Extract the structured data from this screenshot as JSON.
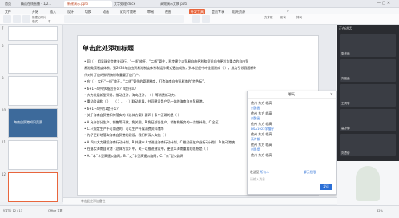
{
  "tabs": [
    "首页",
    "精选在线直播 - 1/2...",
    "新建演示.pptx",
    "文字处理.docx",
    "高效演示文稿 pptx"
  ],
  "menus": [
    "文件",
    "开始",
    "插入",
    "设计",
    "切换",
    "动画",
    "幻灯片放映",
    "审阅",
    "视图",
    "开发工具",
    "会员专享",
    "稻壳资源"
  ],
  "toolbar": {
    "new_slide": "新建幻灯片",
    "layout": "版式",
    "section": "节",
    "textbox": "文本框",
    "shapes": "形状",
    "arrange": "排列"
  },
  "slide": {
    "title": "单击此处添加标题",
    "lines": [
      "• 同（  ）相吴瑞全会转关运行，“一线”放开，“二线”管住，积步建立以贸易自由便利和投资自由便利为重点的自由贸",
      "  易港政策制度体系，到2035年自由贸易港制度体系和运作模式更加成熟，到本世纪中叶全面建成（  ），成为引领我国新时",
      "  代对外开放的鲜明旗帜和重要开放门户。",
      "• 应（  ）实行“一线”放开，“二线”管住的管理制度，打造海南自由贸易港的“特色标”。",
      "• 6+1+4中的6指应什么？4是什么？",
      "• 大力发展新型贸易、推动经济、海岛经济、（  ）等消费新动力。",
      "• 重动及调和（  ）、（  ）、（  ）联动发展，共同建设是产品一体的海南自由贸易港。",
      "• 6+1+4中的1是什么？",
      "• 关于海南自贸港如何落实的《总体方案》要四十条中正确的是（  ）",
      "• A.允许部分生产、销售等开放，免关税，B.免征部分生产、销售和服务的一次性补贴、C.全区",
      "• C.只限定生产不可用途的，可以生产开展消费资料储等",
      "• 为了更好地落实海南自贸港的建设，我们将深入实施（  ）",
      "• A.四川大力建设海南行动计划，B.共建市人才进驻海南行动计划，C.推动开放产业行动计划，D.推动港澳",
      "• 在落实海南自贸港《总体方案》中，关于以推进建设中，更这么海南重要的思想是（  ）",
      "• A. “本”字型高速公路网，B. “之”字型高速公路网，C. “东”型公路网"
    ]
  },
  "notes_placeholder": "单击此处添加备注",
  "chat": {
    "title": "聊天",
    "messages": [
      {
        "name": "刘懿函",
        "text": "儋州 东方 临高"
      },
      {
        "name": "刘懿函",
        "text": "儋州 东方 临高"
      },
      {
        "name": "刘懿函",
        "text": "儋州 东方 临高"
      },
      {
        "name": "刘懿函",
        "text": "儋州 东方 临高"
      },
      {
        "name": "DSA1922学猫仔",
        "text": "儋州 东方 临高"
      },
      {
        "name": "高冷御",
        "text": "儋州 东方 临高"
      },
      {
        "name": "刘思伊",
        "text": "儋州 东方 临高"
      }
    ],
    "to_label": "发送至",
    "to_value": "所有人",
    "perm_label": "聊天权限",
    "input_placeholder": "请输入消息...",
    "send": "发送"
  },
  "video": {
    "title": "正在讲话",
    "participants": [
      "张老师",
      "刘懿函",
      "王同学",
      "高冷御",
      "刘思伊"
    ]
  },
  "status": {
    "left": "幻灯片 12 / 13",
    "theme": "Office 主题",
    "zoom": "62%"
  },
  "thumb_numbers": [
    "7",
    "8",
    "9",
    "10",
    "11",
    "12"
  ],
  "thumb_label": "海南自贸港知识竞赛",
  "colors": {
    "accent": "#e8663d",
    "link": "#2b6fd6",
    "title_bar": "#3d6a9b"
  }
}
